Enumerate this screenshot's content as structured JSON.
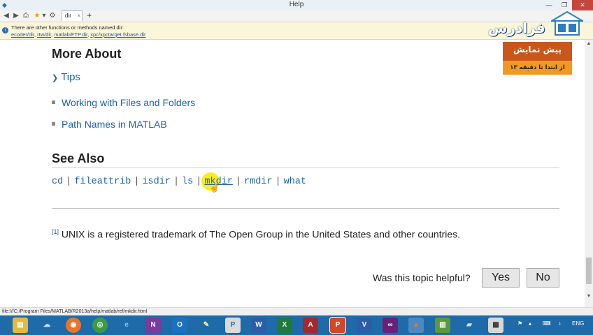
{
  "window": {
    "title": "Help"
  },
  "browser": {
    "tab_label": "dir",
    "tab_close": "×",
    "new_tab": "+"
  },
  "notice": {
    "line1": "There are other functions or methods named dir:",
    "links": [
      "ecoder/dir",
      "rtw/dir",
      "matlab/FTP.dir",
      "xpc/xpctarget.fsbase.dir"
    ]
  },
  "page": {
    "more_about_heading": "More About",
    "tips_label": "Tips",
    "more_about_items": [
      "Working with Files and Folders",
      "Path Names in MATLAB"
    ],
    "see_also_heading": "See Also",
    "see_also_links": [
      "cd",
      "fileattrib",
      "isdir",
      "ls",
      "mkdir",
      "rmdir",
      "what"
    ],
    "footnote_marker": "[1]",
    "footnote_text": "UNIX is a registered trademark of The Open Group in the United States and other countries.",
    "helpful_question": "Was this topic helpful?",
    "yes_label": "Yes",
    "no_label": "No"
  },
  "status_bar": {
    "url": "file:///C:/Program Files/MATLAB/R2013a/help/matlab/ref/mkdir.html"
  },
  "overlay": {
    "logo_text": "فرادرس",
    "promo_title": "پیش نمایش",
    "promo_sub": "از ابتدا تا دقیقه ۱۳"
  },
  "taskbar": {
    "language": "ENG",
    "apps": [
      "explorer-icon",
      "onedrive-icon",
      "firefox-icon",
      "chrome-icon",
      "ie-icon",
      "onenote-icon",
      "outlook-icon",
      "pen-icon",
      "publisher-icon",
      "word-icon",
      "excel-icon",
      "access-icon",
      "powerpoint-icon",
      "visio-icon",
      "visualstudio-icon",
      "matlab-icon",
      "chart-app-icon",
      "app-icon",
      "calculator-icon"
    ],
    "accent": "#1f6aa8"
  }
}
